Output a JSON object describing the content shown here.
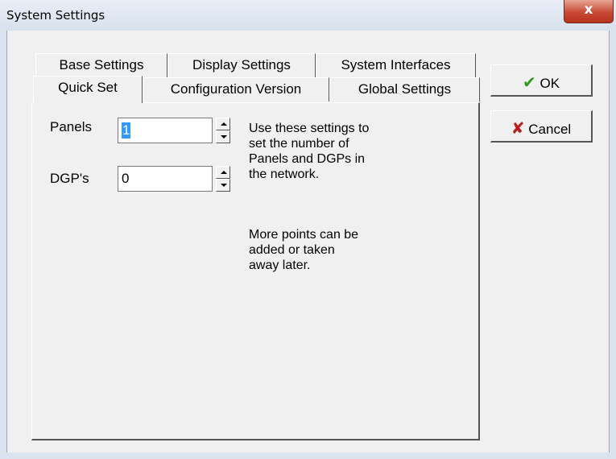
{
  "window": {
    "title": "System Settings",
    "close_glyph": "x"
  },
  "tabs": {
    "row_back": [
      {
        "label": "Base Settings"
      },
      {
        "label": "Display Settings"
      },
      {
        "label": "System Interfaces"
      }
    ],
    "row_front": [
      {
        "label": "Quick Set",
        "active": true
      },
      {
        "label": "Configuration Version"
      },
      {
        "label": "Global Settings"
      }
    ]
  },
  "quick_set": {
    "panels": {
      "label": "Panels",
      "value": "1"
    },
    "dgps": {
      "label": "DGP's",
      "value": "0"
    },
    "help_lines_1": [
      "Use these settings to",
      "set the number of",
      "Panels and DGPs in",
      "the network."
    ],
    "help_lines_2": [
      "More points can be",
      "added or taken",
      "away later."
    ]
  },
  "buttons": {
    "ok": {
      "label": "OK",
      "icon": "check-icon"
    },
    "cancel": {
      "label": "Cancel",
      "icon": "x-icon"
    }
  },
  "colors": {
    "ok_check": "#2e9b1b",
    "cancel_x": "#b81c1c",
    "selection": "#3399ff",
    "close_button": "#c74a36"
  }
}
